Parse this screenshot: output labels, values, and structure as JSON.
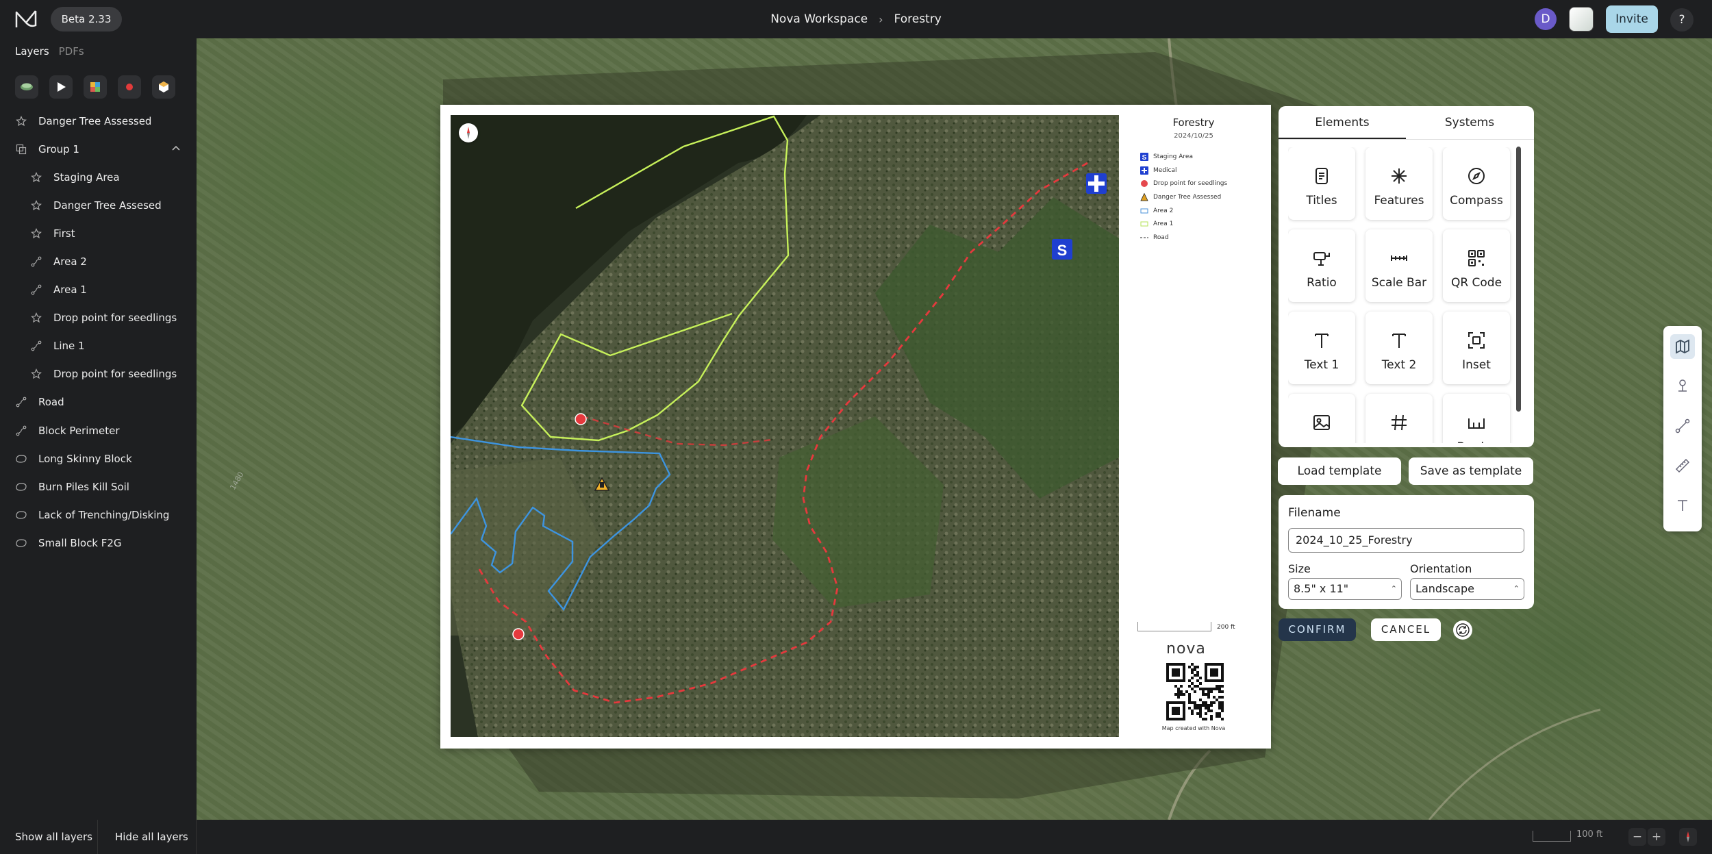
{
  "app": {
    "version_badge": "Beta 2.33",
    "breadcrumb": [
      "Nova Workspace",
      "Forestry"
    ],
    "breadcrumb_separator": "›",
    "avatar_initial": "D",
    "invite_label": "Invite",
    "help_label": "?"
  },
  "sidebar": {
    "tabs": [
      "Layers",
      "PDFs"
    ],
    "type_buttons": [
      "layers-icon",
      "play-icon",
      "image-icon",
      "record-icon",
      "cube-icon"
    ],
    "layers": [
      {
        "label": "Danger Tree Assessed",
        "icon": "star-icon",
        "level": 0
      },
      {
        "label": "Group 1",
        "icon": "group-icon",
        "level": 0,
        "expanded": true
      },
      {
        "label": "Staging Area",
        "icon": "star-icon",
        "level": 1
      },
      {
        "label": "Danger Tree Assesed",
        "icon": "star-icon",
        "level": 1
      },
      {
        "label": "First",
        "icon": "star-icon",
        "level": 1
      },
      {
        "label": "Area 2",
        "icon": "line-icon",
        "level": 1
      },
      {
        "label": "Area 1",
        "icon": "line-icon",
        "level": 1
      },
      {
        "label": "Drop point for seedlings",
        "icon": "star-icon",
        "level": 1
      },
      {
        "label": "Line 1",
        "icon": "line-icon",
        "level": 1
      },
      {
        "label": "Drop point for seedlings",
        "icon": "star-icon",
        "level": 1
      },
      {
        "label": "Road",
        "icon": "line-icon",
        "level": 0
      },
      {
        "label": "Block Perimeter",
        "icon": "line-icon",
        "level": 0
      },
      {
        "label": "Long Skinny Block",
        "icon": "polygon-icon",
        "level": 0
      },
      {
        "label": "Burn Piles Kill Soil",
        "icon": "polygon-icon",
        "level": 0
      },
      {
        "label": "Lack of Trenching/Disking",
        "icon": "polygon-icon",
        "level": 0
      },
      {
        "label": "Small Block F2G",
        "icon": "polygon-icon",
        "level": 0
      }
    ],
    "show_all": "Show all layers",
    "hide_all": "Hide all layers"
  },
  "map": {
    "scale_label": "100 ft",
    "zoom_out": "−",
    "zoom_in": "+",
    "tools": [
      "map-icon",
      "pin-icon",
      "route-icon",
      "ruler-icon",
      "text-icon"
    ],
    "active_tool": "map-icon"
  },
  "print_preview": {
    "title": "Forestry",
    "date": "2024/10/25",
    "legend": [
      {
        "label": "Staging Area",
        "symbol": "staging-icon",
        "color": "#1f3fd0"
      },
      {
        "label": "Medical",
        "symbol": "medical-icon",
        "color": "#1f3fd0"
      },
      {
        "label": "Drop point for seedlings",
        "symbol": "dot-icon",
        "color": "#e5484d"
      },
      {
        "label": "Danger Tree Assessed",
        "symbol": "tree-icon",
        "color": "#e0a020"
      },
      {
        "label": "Area 2",
        "symbol": "area-icon",
        "color": "#4a90d9"
      },
      {
        "label": "Area 1",
        "symbol": "area-icon",
        "color": "#b5e35a"
      },
      {
        "label": "Road",
        "symbol": "dash-icon",
        "color": "#555555"
      }
    ],
    "scale_label": "200 ft",
    "brand": "nova",
    "credit": "Map created with Nova",
    "colors": {
      "area1": "#c6f05a",
      "area2": "#3d94e0",
      "road": "#e5393d"
    }
  },
  "elements_panel": {
    "tabs": [
      "Elements",
      "Systems"
    ],
    "active_tab": "Elements",
    "items": [
      {
        "label": "Titles",
        "icon": "title-icon"
      },
      {
        "label": "Features",
        "icon": "asterisk-icon"
      },
      {
        "label": "Compass",
        "icon": "compass-icon"
      },
      {
        "label": "Ratio",
        "icon": "ratio-icon"
      },
      {
        "label": "Scale Bar",
        "icon": "scale-bar-icon"
      },
      {
        "label": "QR Code",
        "icon": "qr-code-icon"
      },
      {
        "label": "Text 1",
        "icon": "text-icon"
      },
      {
        "label": "Text 2",
        "icon": "text-icon"
      },
      {
        "label": "Inset",
        "icon": "inset-icon"
      },
      {
        "label": "",
        "icon": "image-icon"
      },
      {
        "label": "",
        "icon": "grid-icon"
      },
      {
        "label": "Border",
        "icon": "border-icon"
      }
    ]
  },
  "template": {
    "load_label": "Load template",
    "save_label": "Save as template"
  },
  "export": {
    "filename_label": "Filename",
    "filename_value": "2024_10_25_Forestry",
    "size_label": "Size",
    "size_value": "8.5\" x 11\"",
    "orientation_label": "Orientation",
    "orientation_value": "Landscape",
    "confirm_label": "CONFIRM",
    "cancel_label": "CANCEL"
  }
}
